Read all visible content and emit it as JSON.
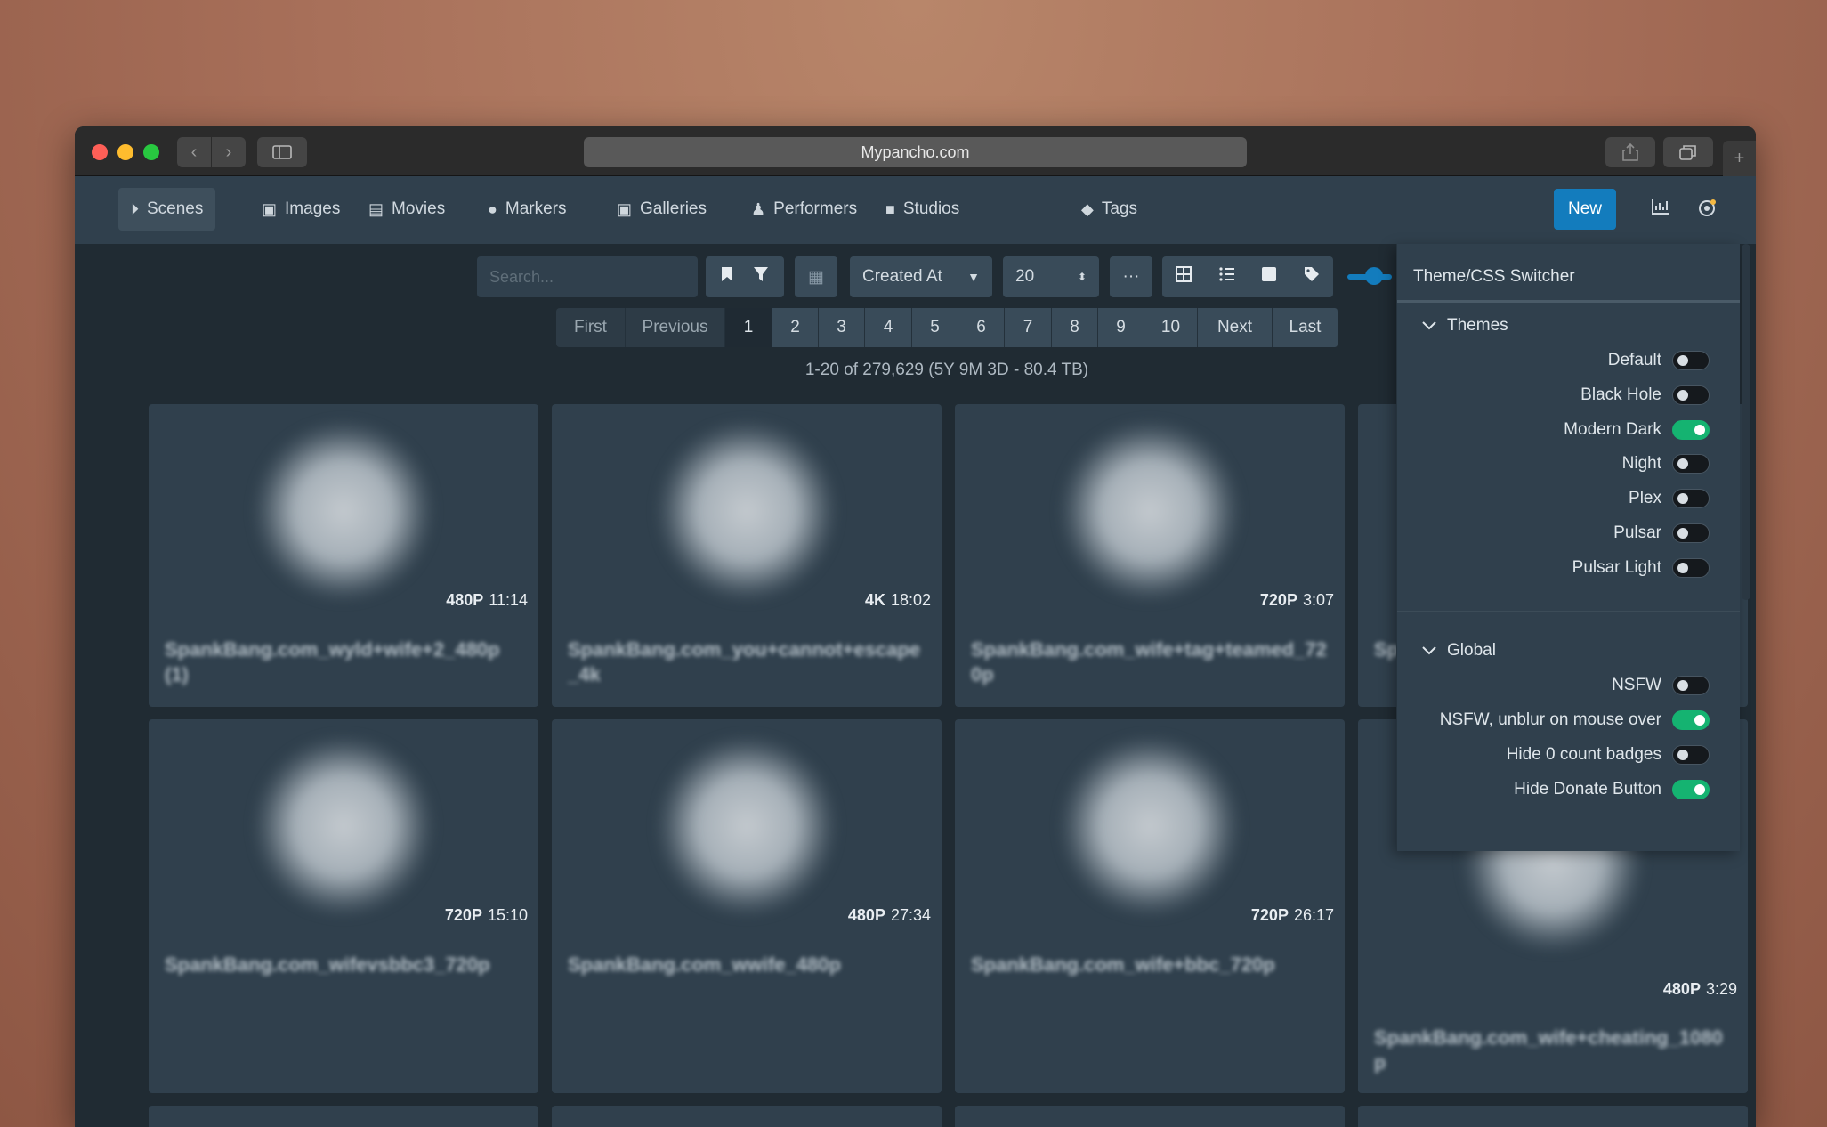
{
  "browser": {
    "url": "Mypancho.com",
    "back_icon": "chevron-left-icon",
    "forward_icon": "chevron-right-icon"
  },
  "nav": {
    "items": [
      {
        "label": "Scenes",
        "icon": "play-circle-icon"
      },
      {
        "label": "Images",
        "icon": "image-icon"
      },
      {
        "label": "Movies",
        "icon": "film-icon"
      },
      {
        "label": "Markers",
        "icon": "map-marker-icon"
      },
      {
        "label": "Galleries",
        "icon": "images-icon"
      },
      {
        "label": "Performers",
        "icon": "user-icon"
      },
      {
        "label": "Studios",
        "icon": "video-camera-icon"
      },
      {
        "label": "Tags",
        "icon": "tag-icon"
      }
    ],
    "active": "Scenes",
    "new_label": "New"
  },
  "toolbar": {
    "search_placeholder": "Search...",
    "sort_by": "Created At",
    "per_page": "20",
    "more_label": "···"
  },
  "pagination": {
    "first": "First",
    "previous": "Previous",
    "pages": [
      "1",
      "2",
      "3",
      "4",
      "5",
      "6",
      "7",
      "8",
      "9",
      "10"
    ],
    "current": "1",
    "next": "Next",
    "last": "Last"
  },
  "result_summary": "1-20 of 279,629 (5Y 9M 3D - 80.4 TB)",
  "scenes": [
    {
      "resolution": "480P",
      "duration": "11:14",
      "title": "SpankBang.com_wyld+wife+2_480p (1)"
    },
    {
      "resolution": "4K",
      "duration": "18:02",
      "title": "SpankBang.com_you+cannot+escape_4k"
    },
    {
      "resolution": "720P",
      "duration": "3:07",
      "title": "SpankBang.com_wife+tag+teamed_720p"
    },
    {
      "resolution": "720P",
      "duration": "15:10",
      "title": "SpankBang.com_wifevsbbc3_720p"
    },
    {
      "resolution": "480P",
      "duration": "27:34",
      "title": "SpankBang.com_wwife_480p"
    },
    {
      "resolution": "720P",
      "duration": "26:17",
      "title": "SpankBang.com_wife+bbc_720p"
    },
    {
      "resolution": "480P",
      "duration": "3:29",
      "title": "SpankBang.com_wife+cheating_1080p"
    }
  ],
  "partial_card": {
    "title": "Sp +"
  },
  "theme_panel": {
    "title": "Theme/CSS Switcher",
    "themes_header": "Themes",
    "themes": [
      {
        "label": "Default",
        "on": false
      },
      {
        "label": "Black Hole",
        "on": false
      },
      {
        "label": "Modern Dark",
        "on": true
      },
      {
        "label": "Night",
        "on": false
      },
      {
        "label": "Plex",
        "on": false
      },
      {
        "label": "Pulsar",
        "on": false
      },
      {
        "label": "Pulsar Light",
        "on": false
      }
    ],
    "global_header": "Global",
    "global": [
      {
        "label": "NSFW",
        "on": false
      },
      {
        "label": "NSFW, unblur on mouse over",
        "on": true
      },
      {
        "label": "Hide 0 count badges",
        "on": false
      },
      {
        "label": "Hide Donate Button",
        "on": true
      }
    ]
  },
  "colors": {
    "accent": "#137cbd",
    "toggle_on": "#15b371",
    "navbar": "#30404d",
    "background": "#202b33"
  }
}
